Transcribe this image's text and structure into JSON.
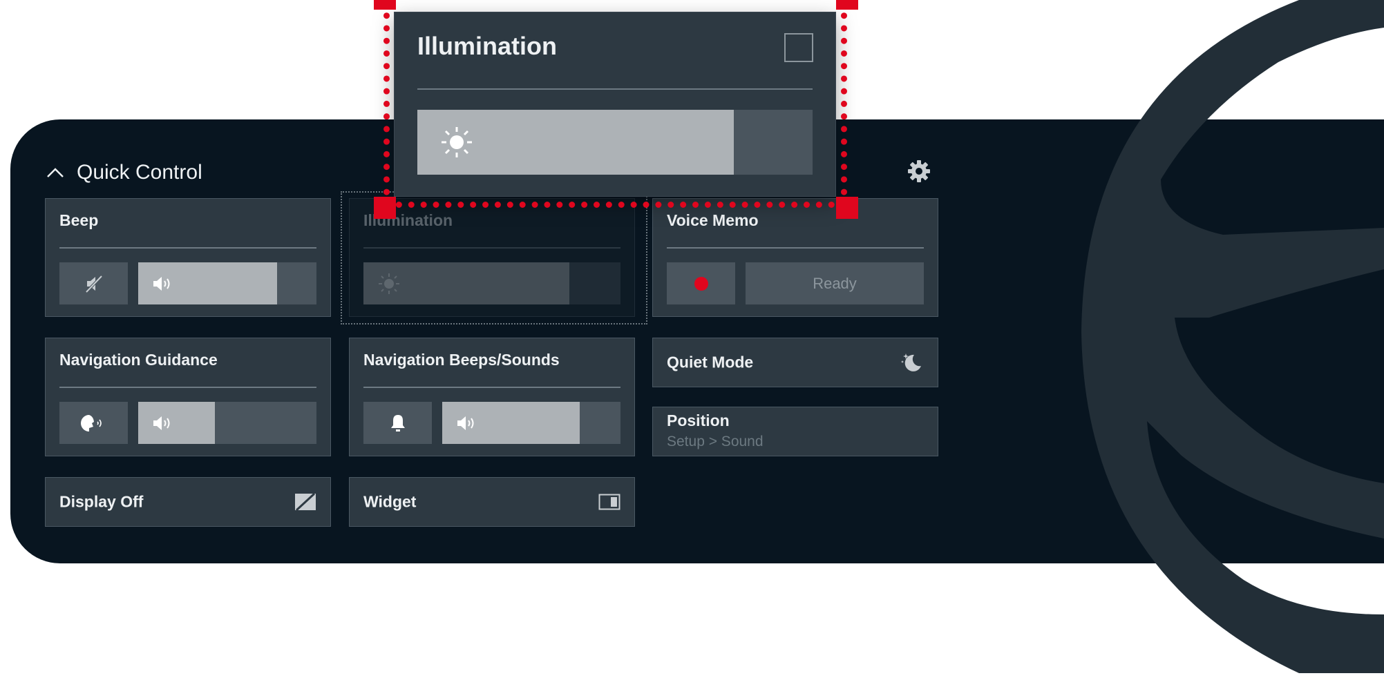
{
  "quick_control": {
    "title": "Quick Control",
    "icons": {
      "collapse": "chevron-up-icon",
      "settings": "gear-icon"
    }
  },
  "cards": {
    "beep": {
      "title": "Beep",
      "mute_icon": "speaker-mute-icon",
      "volume_icon": "speaker-icon",
      "level": 0.79
    },
    "illumination_ghost": {
      "title": "Illumination",
      "icon": "sun-icon",
      "level": 0.8
    },
    "voice_memo": {
      "title": "Voice Memo",
      "record_icon": "record-dot-icon",
      "status": "Ready",
      "record_color": "#e0061e"
    },
    "navigation_guidance": {
      "title": "Navigation Guidance",
      "voice_icon": "voice-guidance-icon",
      "volume_icon": "speaker-icon",
      "level": 0.44
    },
    "navigation_beeps": {
      "title": "Navigation Beeps/Sounds",
      "bell_icon": "bell-icon",
      "volume_icon": "speaker-icon",
      "level": 0.78
    },
    "quiet_mode": {
      "title": "Quiet Mode",
      "icon": "moon-stars-icon"
    },
    "position": {
      "title": "Position",
      "subtitle": "Setup > Sound"
    },
    "display_off": {
      "title": "Display Off",
      "icon": "display-off-icon"
    },
    "widget": {
      "title": "Widget",
      "icon": "widget-icon"
    }
  },
  "popup": {
    "title": "Illumination",
    "checkbox_icon": "checkbox-icon",
    "icon": "sun-icon",
    "level": 0.8
  },
  "colors": {
    "panel": "#081520",
    "card": "#2d3942",
    "selection": "#e0061e",
    "bar_fill": "#adb2b6",
    "bar_track": "#4a555e"
  }
}
